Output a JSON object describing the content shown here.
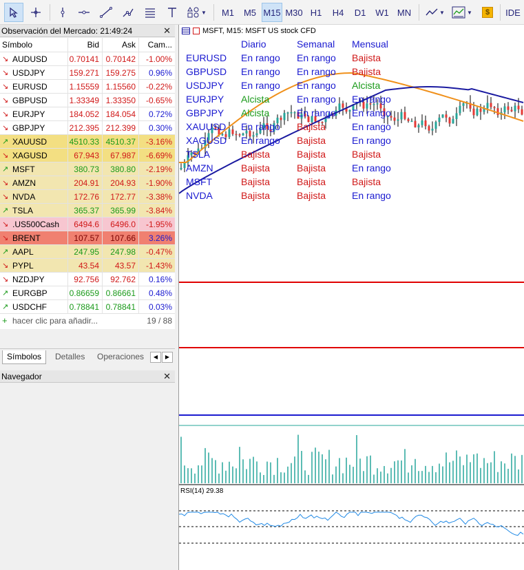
{
  "toolbar": {
    "timeframes": [
      "M1",
      "M5",
      "M15",
      "M30",
      "H1",
      "H4",
      "D1",
      "W1",
      "MN"
    ],
    "selected_timeframe": "M15",
    "ide_label": "IDE"
  },
  "market_watch": {
    "title": "Observación del Mercado: 21:49:24",
    "columns": [
      "Símbolo",
      "Bid",
      "Ask",
      "Cam..."
    ],
    "rows": [
      {
        "symbol": "AUDUSD",
        "bid": "0.70141",
        "ask": "0.70142",
        "change": "-1.00%",
        "dir": "down",
        "bg": "#ffffff"
      },
      {
        "symbol": "USDJPY",
        "bid": "159.271",
        "ask": "159.275",
        "change": "0.96%",
        "dir": "down",
        "bg": "#ffffff"
      },
      {
        "symbol": "EURUSD",
        "bid": "1.15559",
        "ask": "1.15560",
        "change": "-0.22%",
        "dir": "down",
        "bg": "#ffffff"
      },
      {
        "symbol": "GBPUSD",
        "bid": "1.33349",
        "ask": "1.33350",
        "change": "-0.65%",
        "dir": "down",
        "bg": "#ffffff"
      },
      {
        "symbol": "EURJPY",
        "bid": "184.052",
        "ask": "184.054",
        "change": "0.72%",
        "dir": "down",
        "bg": "#ffffff"
      },
      {
        "symbol": "GBPJPY",
        "bid": "212.395",
        "ask": "212.399",
        "change": "0.30%",
        "dir": "down",
        "bg": "#ffffff"
      },
      {
        "symbol": "XAUUSD",
        "bid": "4510.33",
        "ask": "4510.37",
        "change": "-3.16%",
        "dir": "up",
        "bg": "#f3df82"
      },
      {
        "symbol": "XAGUSD",
        "bid": "67.943",
        "ask": "67.987",
        "change": "-6.69%",
        "dir": "down",
        "bg": "#f3df82"
      },
      {
        "symbol": "MSFT",
        "bid": "380.73",
        "ask": "380.80",
        "change": "-2.19%",
        "dir": "up",
        "bg": "#f2e6b0"
      },
      {
        "symbol": "AMZN",
        "bid": "204.91",
        "ask": "204.93",
        "change": "-1.90%",
        "dir": "down",
        "bg": "#f2e6b0"
      },
      {
        "symbol": "NVDA",
        "bid": "172.76",
        "ask": "172.77",
        "change": "-3.38%",
        "dir": "down",
        "bg": "#f2e6b0"
      },
      {
        "symbol": "TSLA",
        "bid": "365.37",
        "ask": "365.99",
        "change": "-3.84%",
        "dir": "up",
        "bg": "#f2e6b0"
      },
      {
        "symbol": ".US500Cash",
        "bid": "6494.6",
        "ask": "6496.0",
        "change": "-1.95%",
        "dir": "down",
        "bg": "#f7c6d0"
      },
      {
        "symbol": "BRENT",
        "bid": "107.57",
        "ask": "107.66",
        "change": "3.26%",
        "dir": "down",
        "bg": "#f08070"
      },
      {
        "symbol": "AAPL",
        "bid": "247.95",
        "ask": "247.98",
        "change": "-0.47%",
        "dir": "up",
        "bg": "#f2e6b0"
      },
      {
        "symbol": "PYPL",
        "bid": "43.54",
        "ask": "43.57",
        "change": "-1.43%",
        "dir": "down",
        "bg": "#f2e6b0"
      },
      {
        "symbol": "NZDJPY",
        "bid": "92.756",
        "ask": "92.762",
        "change": "0.16%",
        "dir": "down",
        "bg": "#ffffff"
      },
      {
        "symbol": "EURGBP",
        "bid": "0.86659",
        "ask": "0.86661",
        "change": "0.48%",
        "dir": "up",
        "bg": "#ffffff"
      },
      {
        "symbol": "USDCHF",
        "bid": "0.78841",
        "ask": "0.78841",
        "change": "0.03%",
        "dir": "up",
        "bg": "#ffffff"
      }
    ],
    "add_hint": "hacer clic para añadir...",
    "count": "19 / 88",
    "tabs": [
      "Símbolos",
      "Detalles",
      "Operaciones"
    ]
  },
  "navigator": {
    "title": "Navegador"
  },
  "chart": {
    "title": "MSFT, M15:  MSFT US stock CFD",
    "rsi_label": "RSI(14) 29.38",
    "trend_headers": [
      "Diario",
      "Semanal",
      "Mensual"
    ],
    "trend_rows": [
      {
        "symbol": "EURUSD",
        "values": [
          "En rango",
          "En rango",
          "Bajista"
        ]
      },
      {
        "symbol": "GBPUSD",
        "values": [
          "En rango",
          "En rango",
          "Bajista"
        ]
      },
      {
        "symbol": "USDJPY",
        "values": [
          "En rango",
          "En rango",
          "Alcista"
        ]
      },
      {
        "symbol": "EURJPY",
        "values": [
          "Alcista",
          "En rango",
          "En rango"
        ]
      },
      {
        "symbol": "GBPJPY",
        "values": [
          "Alcista",
          "En rango",
          "En rango"
        ]
      },
      {
        "symbol": "XAUUSD",
        "values": [
          "En rango",
          "Bajista",
          "En rango"
        ]
      },
      {
        "symbol": "XAGUSD",
        "values": [
          "En rango",
          "Bajista",
          "En rango"
        ]
      },
      {
        "symbol": "TSLA",
        "values": [
          "Bajista",
          "Bajista",
          "Bajista"
        ]
      },
      {
        "symbol": "AMZN",
        "values": [
          "Bajista",
          "Bajista",
          "En rango"
        ]
      },
      {
        "symbol": "MSFT",
        "values": [
          "Bajista",
          "Bajista",
          "Bajista"
        ]
      },
      {
        "symbol": "NVDA",
        "values": [
          "Bajista",
          "Bajista",
          "En rango"
        ]
      }
    ],
    "colors": {
      "symbol": "#1a1ad0",
      "header": "#1a1ad0",
      "en_rango": "#1a1ad0",
      "bajista": "#d01818",
      "alcista": "#1a9a1a",
      "bull_candle": "#26a69a",
      "bear_candle": "#e53935",
      "ma_fast": "#f0901a",
      "ma_slow": "#1a1aa0"
    }
  }
}
